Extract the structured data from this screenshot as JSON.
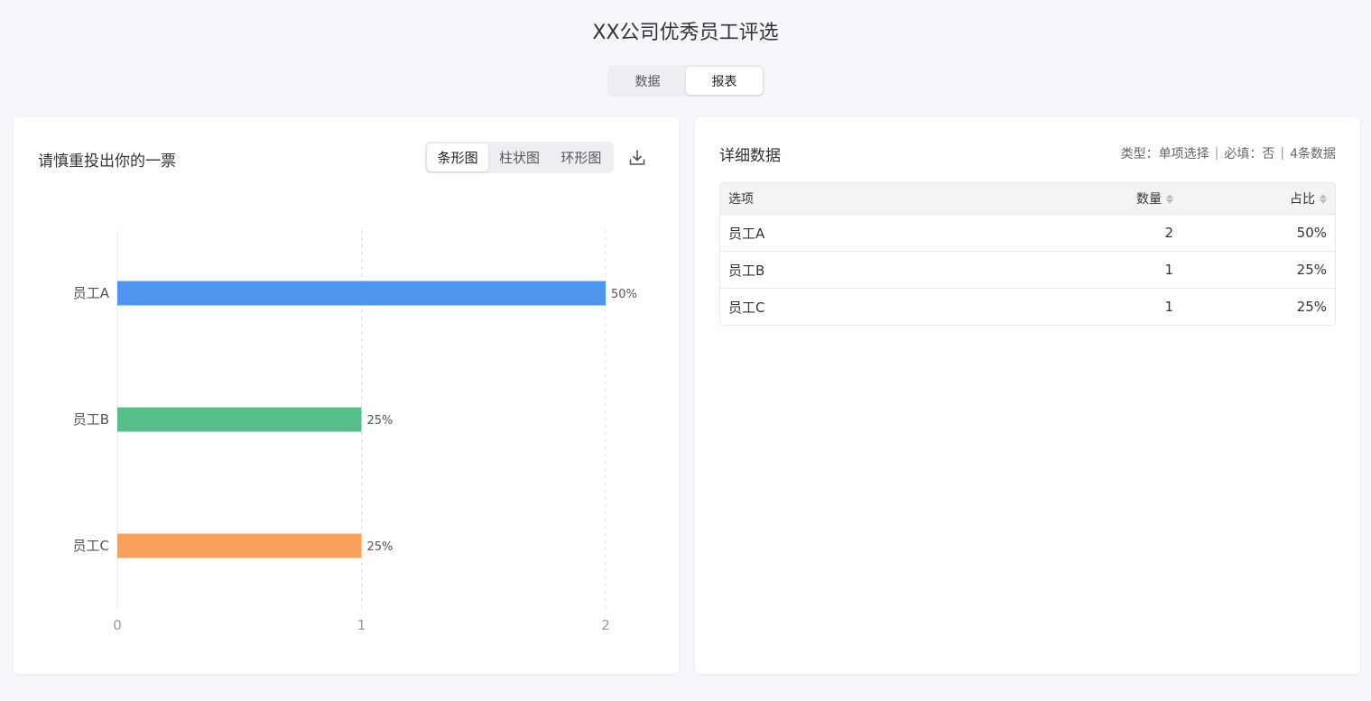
{
  "page": {
    "title": "XX公司优秀员工评选"
  },
  "view_tabs": {
    "items": [
      "数据",
      "报表"
    ],
    "active": "报表"
  },
  "question": {
    "title": "请慎重投出你的一票",
    "chart_types": [
      "条形图",
      "柱状图",
      "环形图"
    ],
    "active_chart_type": "条形图",
    "download_icon": "download-icon"
  },
  "chart_data": {
    "type": "bar",
    "orientation": "horizontal",
    "categories": [
      "员工A",
      "员工B",
      "员工C"
    ],
    "values": [
      2,
      1,
      1
    ],
    "labels": [
      "50%",
      "25%",
      "25%"
    ],
    "colors": [
      "#4e95ef",
      "#55be89",
      "#f7a05a"
    ],
    "xlim": [
      0,
      2
    ],
    "xticks": [
      "0",
      "1",
      "2"
    ],
    "grid": true
  },
  "detail": {
    "title": "详细数据",
    "meta": {
      "type_label": "类型：单项选择",
      "required_label": "必填：否",
      "count_label": "4条数据"
    },
    "columns": [
      "选项",
      "数量",
      "占比"
    ],
    "rows": [
      [
        "员工A",
        "2",
        "50%"
      ],
      [
        "员工B",
        "1",
        "25%"
      ],
      [
        "员工C",
        "1",
        "25%"
      ]
    ]
  }
}
